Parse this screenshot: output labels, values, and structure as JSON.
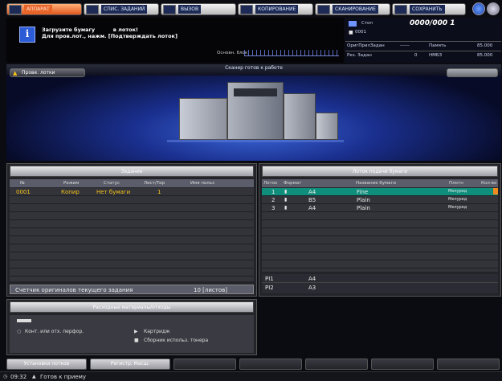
{
  "tabs": [
    {
      "label": "АППАРАТ",
      "active": true
    },
    {
      "label": "СПИС. ЗАДАНИЙ"
    },
    {
      "label": "ВЫЗОВ"
    },
    {
      "label": "КОПИРОВАНИЕ"
    },
    {
      "label": "СКАНИРОВАНИЕ"
    },
    {
      "label": "СОХРАНИТЬ"
    }
  ],
  "message": {
    "line1": "Загрузите бумагу          в лоток!",
    "line2": "Для пров.лот., нажм. [Подтверждать лоток]"
  },
  "counter": {
    "stack_label": "Стоп",
    "count": "0000/000 1",
    "copies": "0001",
    "orig_label": "ОригПрилЗадан",
    "orig_value": "------",
    "memory_label": "Память",
    "memory_value": "85.000",
    "res_label": "Рез. Задан",
    "res_value": "0",
    "hdd_label": "НМБЗ",
    "hdd_value": "85.000",
    "block_label": "Основн. блок"
  },
  "banner": {
    "warning_button": "Прове. лотки",
    "status_text": "Сканер готов к работе"
  },
  "jobs": {
    "title": "Задание",
    "columns": [
      "№",
      "Режим",
      "Статус",
      "Лист/Тир",
      "Имя польз"
    ],
    "rows": [
      {
        "num": "0001",
        "mode": "Копир",
        "status": "Нет бумаги",
        "sheets": "1",
        "user": ""
      }
    ],
    "counter_label": "Счетчик оригиналов текущего задания",
    "counter_value": "10 [листов]"
  },
  "tray": {
    "title": "Лоток подачи бумаги",
    "columns": [
      "Лоток",
      "Формат",
      "Название бумаги",
      "Плотн",
      "Кол-во"
    ],
    "rows": [
      {
        "tray": "1",
        "size": "A4",
        "name": "Fine",
        "weight": "Мелуред",
        "selected": true
      },
      {
        "tray": "2",
        "size": "B5",
        "name": "Plain",
        "weight": "Мелуред",
        "selected": false
      },
      {
        "tray": "3",
        "size": "A4",
        "name": "Plain",
        "weight": "Мелуред",
        "selected": false
      }
    ],
    "pi_rows": [
      {
        "tray": "PI1",
        "size": "A4"
      },
      {
        "tray": "PI2",
        "size": "A3"
      }
    ]
  },
  "consumables": {
    "title": "Расходные материалы/отходы",
    "item_staples": "Конт. или отх. перфор.",
    "item_cartridge": "Картридж",
    "item_toner": "Сборник использ. тонера"
  },
  "bottom_buttons": {
    "tray_settings": "Установки лотков",
    "register": "Регистр. Масш.",
    "dim3": "",
    "dim4": "",
    "dim5": "",
    "dim6": "",
    "dim7": ""
  },
  "statusbar": {
    "time": "09:32",
    "state": "Готов к приему"
  },
  "colors": {
    "active_tab": "#e8652a",
    "selected_row": "#0f8e7c",
    "banner_blue": "#1a2f8e",
    "warning_yellow": "#f6c21a"
  }
}
